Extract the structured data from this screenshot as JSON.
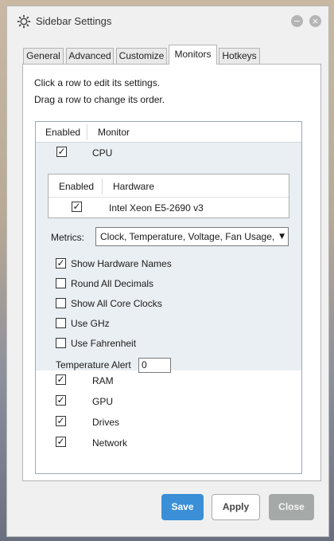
{
  "window": {
    "title": "Sidebar Settings",
    "minimize_glyph": "−",
    "close_glyph": "×"
  },
  "tabs": [
    {
      "label": "General"
    },
    {
      "label": "Advanced"
    },
    {
      "label": "Customize"
    },
    {
      "label": "Monitors",
      "active": true
    },
    {
      "label": "Hotkeys"
    }
  ],
  "instructions": {
    "line1": "Click a row to edit its settings.",
    "line2": "Drag a row to change its order."
  },
  "monitor_list": {
    "col_enabled": "Enabled",
    "col_monitor": "Monitor",
    "cpu": {
      "name": "CPU",
      "enabled": true,
      "hardware": {
        "col_enabled": "Enabled",
        "col_hardware": "Hardware",
        "items": [
          {
            "name": "Intel Xeon E5-2690 v3",
            "enabled": true
          }
        ]
      },
      "metrics_label": "Metrics:",
      "metrics_value": "Clock, Temperature, Voltage, Fan Usage, L",
      "options": [
        {
          "label": "Show Hardware Names",
          "checked": true
        },
        {
          "label": "Round All Decimals",
          "checked": false
        },
        {
          "label": "Show All Core Clocks",
          "checked": false
        },
        {
          "label": "Use GHz",
          "checked": false
        },
        {
          "label": "Use Fahrenheit",
          "checked": false
        }
      ],
      "temp_alert_label": "Temperature Alert",
      "temp_alert_value": "0"
    },
    "others": [
      {
        "name": "RAM",
        "enabled": true
      },
      {
        "name": "GPU",
        "enabled": true
      },
      {
        "name": "Drives",
        "enabled": true
      },
      {
        "name": "Network",
        "enabled": true
      }
    ]
  },
  "buttons": {
    "save": "Save",
    "apply": "Apply",
    "close": "Close"
  },
  "check_glyph": "✓",
  "colors": {
    "accent": "#3a8fd6",
    "selected_row": "#eaeff3",
    "disabled_button": "#a5aaa8"
  }
}
